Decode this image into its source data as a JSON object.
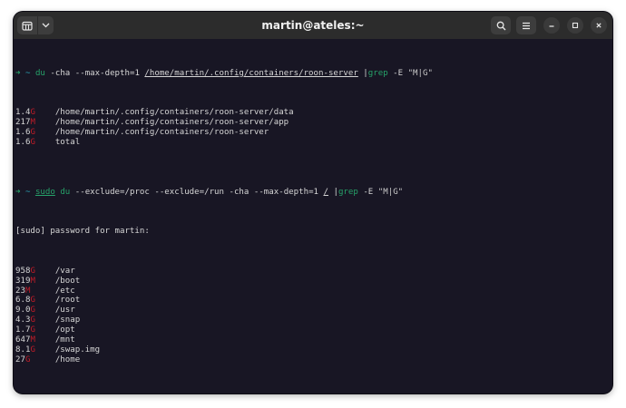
{
  "window": {
    "title": "martin@ateles:~"
  },
  "icons": {
    "new_tab": "new-tab-icon",
    "dropdown": "chevron-down-icon",
    "search": "search-icon",
    "menu": "hamburger-menu-icon",
    "minimize": "minimize-icon",
    "maximize": "maximize-icon",
    "close": "close-icon"
  },
  "colors": {
    "terminal_bg": "#181624",
    "titlebar_bg": "#2c2c2c",
    "prompt_green": "#26a269",
    "command_cyan": "#2aa1b3",
    "grep_match_red": "#c01c28"
  },
  "terminal": {
    "cmd1": {
      "arrow": "➜",
      "tilde": "~",
      "cmd": "du",
      "args": " -cha --max-depth=1 ",
      "path": "/home/martin/.config/containers/roon-server",
      "pipe": " |",
      "grep": "grep",
      "grep_args": " -E ",
      "pattern": "\"M|G\""
    },
    "out1": [
      {
        "num": "1.4",
        "unit": "G",
        "path": "/home/martin/.config/containers/roon-server/data"
      },
      {
        "num": "217",
        "unit": "M",
        "path": "/home/martin/.config/containers/roon-server/app"
      },
      {
        "num": "1.6",
        "unit": "G",
        "path": "/home/martin/.config/containers/roon-server"
      },
      {
        "num": "1.6",
        "unit": "G",
        "path": "total"
      }
    ],
    "cmd2": {
      "arrow": "➜",
      "tilde": "~",
      "sudo": "sudo",
      "cmd": "du",
      "args": " --exclude=/proc --exclude=/run -cha --max-depth=1 ",
      "path": "/",
      "pipe": " |",
      "grep": "grep",
      "grep_args": " -E ",
      "pattern": "\"M|G\""
    },
    "sudo_prompt": "[sudo] password for martin:",
    "out2": [
      {
        "num": "958",
        "unit": "G",
        "path": "/var"
      },
      {
        "num": "319",
        "unit": "M",
        "path": "/boot"
      },
      {
        "num": "23",
        "unit": "M",
        "path": "/etc"
      },
      {
        "num": "6.8",
        "unit": "G",
        "path": "/root"
      },
      {
        "num": "9.0",
        "unit": "G",
        "path": "/usr"
      },
      {
        "num": "4.3",
        "unit": "G",
        "path": "/snap"
      },
      {
        "num": "1.7",
        "unit": "G",
        "path": "/opt"
      },
      {
        "num": "647",
        "unit": "M",
        "path": "/mnt"
      },
      {
        "num": "8.1",
        "unit": "G",
        "path": "/swap.img"
      },
      {
        "num": "27",
        "unit": "G",
        "path": "/home"
      }
    ],
    "final_prompt": {
      "arrow": "➜",
      "tilde": "~"
    }
  }
}
